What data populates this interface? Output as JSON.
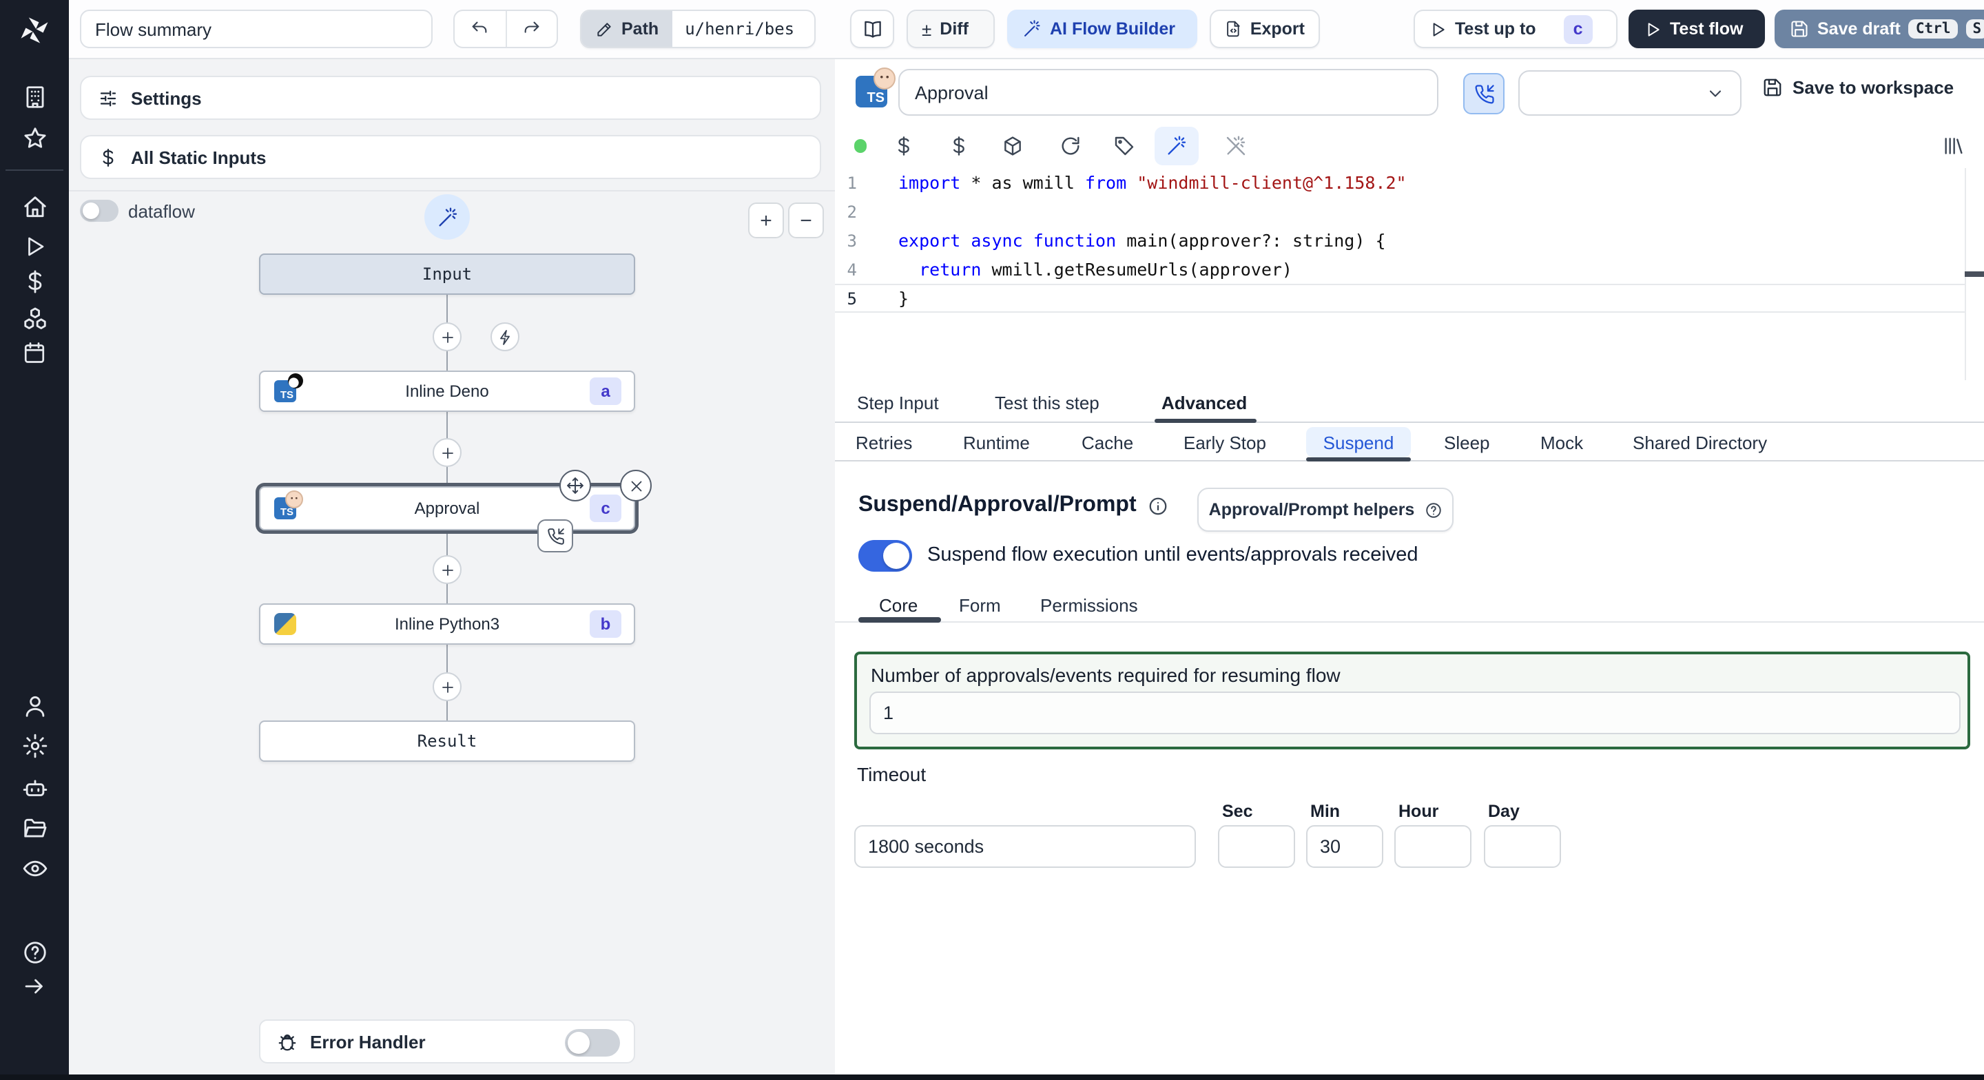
{
  "topbar": {
    "flow_summary": "Flow summary",
    "path_label": "Path",
    "path_value": "u/henri/bes",
    "diff": "Diff",
    "ai_flow_builder": "AI Flow Builder",
    "export": "Export",
    "test_up_to": "Test up to",
    "test_badge": "c",
    "test_flow": "Test flow",
    "save_draft": "Save draft",
    "key_ctrl": "Ctrl",
    "key_s": "S"
  },
  "sidebar": {
    "icons": [
      "building",
      "star",
      "home",
      "play",
      "dollar",
      "cubes",
      "calendar",
      "user",
      "settings",
      "robot",
      "folder",
      "eye",
      "help",
      "arrow-right"
    ]
  },
  "flow": {
    "settings": "Settings",
    "all_static_inputs": "All Static Inputs",
    "dataflow": "dataflow",
    "zoom_in": "+",
    "zoom_out": "−",
    "input_node": "Input",
    "steps": [
      {
        "label": "Inline Deno",
        "badge": "a"
      },
      {
        "label": "Approval",
        "badge": "c"
      },
      {
        "label": "Inline Python3",
        "badge": "b"
      }
    ],
    "result_node": "Result",
    "error_handler": "Error Handler"
  },
  "step": {
    "title": "Approval",
    "save_to_workspace": "Save to workspace",
    "editor": {
      "lines": [
        {
          "n": "1",
          "tokens": [
            {
              "t": "import"
            },
            {
              "t": " * as wmill "
            },
            {
              "t": "from"
            },
            {
              "t": " "
            },
            {
              "t": "\"windmill-client@^1.158.2\""
            }
          ]
        },
        {
          "n": "2",
          "tokens": []
        },
        {
          "n": "3",
          "tokens": [
            {
              "t": "export"
            },
            {
              "t": " "
            },
            {
              "t": "async"
            },
            {
              "t": " "
            },
            {
              "t": "function"
            },
            {
              "t": " main(approver?: string) {"
            }
          ]
        },
        {
          "n": "4",
          "tokens": [
            {
              "t": "  "
            },
            {
              "t": "return"
            },
            {
              "t": " wmill.getResumeUrls(approver)"
            }
          ]
        },
        {
          "n": "5",
          "tokens": [
            {
              "t": "}"
            }
          ]
        }
      ]
    },
    "tabs": [
      "Step Input",
      "Test this step",
      "Advanced"
    ],
    "active_tab": "Advanced",
    "advanced_tabs": [
      "Retries",
      "Runtime",
      "Cache",
      "Early Stop",
      "Suspend",
      "Sleep",
      "Mock",
      "Shared Directory"
    ],
    "active_advanced_tab": "Suspend",
    "suspend": {
      "heading": "Suspend/Approval/Prompt",
      "helpers_button": "Approval/Prompt helpers",
      "toggle_label": "Suspend flow execution until events/approvals received",
      "tabs": [
        "Core",
        "Form",
        "Permissions"
      ],
      "active_sub_tab": "Core",
      "approvals_label": "Number of approvals/events required for resuming flow",
      "approvals_value": "1",
      "timeout_label": "Timeout",
      "timeout_value": "1800 seconds",
      "units": [
        "Sec",
        "Min",
        "Hour",
        "Day"
      ],
      "min_value": "30"
    }
  },
  "colors": {
    "toggle_on": "#3566e0",
    "suspend_box_border": "#2b6a3f",
    "badge_bg": "#dfe4fc",
    "badge_text": "#4338ca",
    "keyword": "#0000ff",
    "string": "#a31515",
    "test_flow_bg": "#222b3b",
    "save_draft_bg": "#6d84a2",
    "ai_builder_bg": "#dbeafe",
    "ai_builder_text": "#1e40af",
    "status_dot": "#5bd36a"
  }
}
